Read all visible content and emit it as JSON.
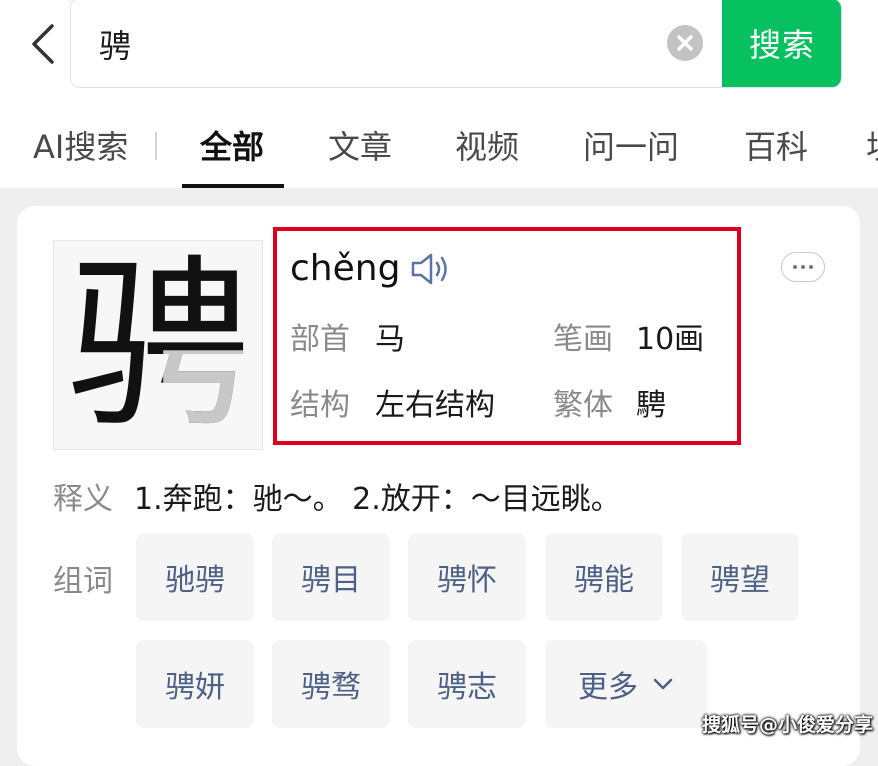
{
  "search": {
    "query": "骋",
    "button_label": "搜索"
  },
  "tabs": [
    {
      "label": "AI搜索"
    },
    {
      "label": "全部",
      "active": true
    },
    {
      "label": "文章"
    },
    {
      "label": "视频"
    },
    {
      "label": "问一问"
    },
    {
      "label": "百科"
    },
    {
      "label": "块"
    }
  ],
  "character": {
    "glyph": "骋",
    "pinyin": "chěng",
    "radical_label": "部首",
    "radical": "马",
    "strokes_label": "笔画",
    "strokes": "10画",
    "structure_label": "结构",
    "structure": "左右结构",
    "traditional_label": "繁体",
    "traditional": "騁"
  },
  "meaning": {
    "label": "释义",
    "text": "1.奔跑：驰～。 2.放开：～目远眺。"
  },
  "words": {
    "label": "组词",
    "items": [
      "驰骋",
      "骋目",
      "骋怀",
      "骋能",
      "骋望",
      "骋妍",
      "骋骛",
      "骋志"
    ],
    "more_label": "更多"
  },
  "watermark": "搜狐号@小俊爱分享",
  "colors": {
    "accent_green": "#07c160",
    "highlight_red": "#e0001b",
    "word_text": "#4d6186"
  }
}
